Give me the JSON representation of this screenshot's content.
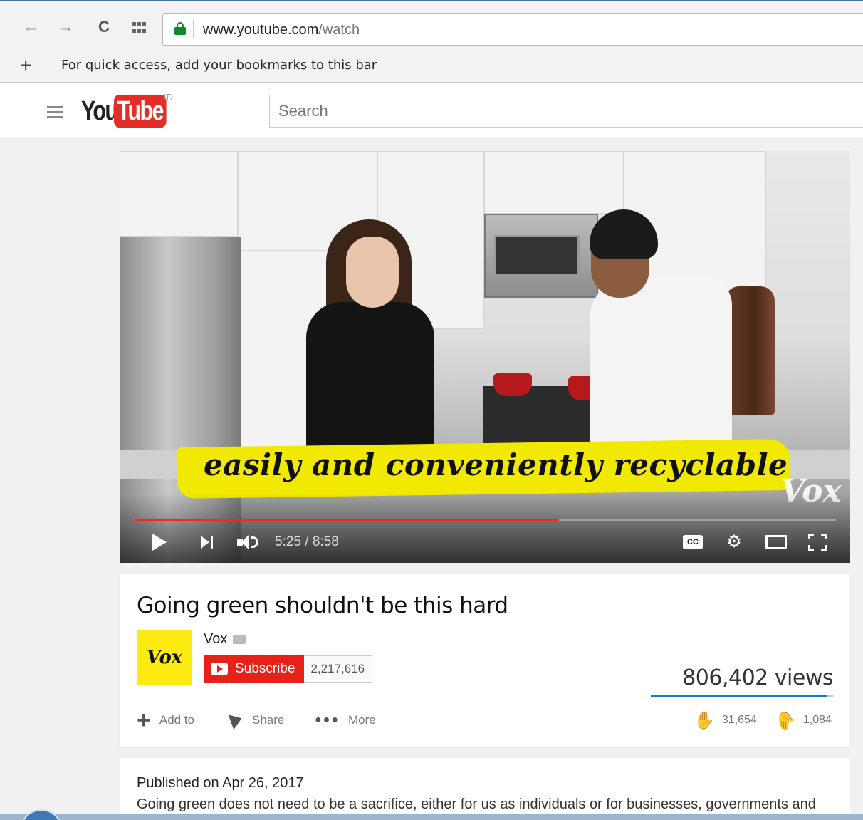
{
  "browser": {
    "url_domain": "www.youtube.com",
    "url_path": "/watch",
    "bookmarks_hint": "For quick access, add your bookmarks to this bar",
    "icons": [
      "back-icon",
      "forward-icon",
      "reload-icon",
      "apps-icon",
      "lock-icon",
      "add-bookmark-icon"
    ]
  },
  "header": {
    "logo_you": "You",
    "logo_tube": "Tube",
    "logo_region": "ID",
    "search_placeholder": "Search"
  },
  "player": {
    "caption": "easily and conveniently recyclable",
    "watermark": "Vox",
    "time_current": "5:25",
    "time_separator": " / ",
    "time_total": "8:58",
    "progress_fraction": 0.605,
    "cc_label": "CC",
    "accent_color": "#e52d27"
  },
  "video": {
    "title": "Going green shouldn't be this hard",
    "channel_name": "Vox",
    "channel_avatar_text": "Vox",
    "subscribe_label": "Subscribe",
    "subscriber_count": "2,217,616",
    "views": "806,402 views",
    "like_ratio": 0.967,
    "actions": {
      "add_to": "Add to",
      "share": "Share",
      "more": "More"
    },
    "likes": "31,654",
    "dislikes": "1,084"
  },
  "description": {
    "published": "Published on Apr 26, 2017",
    "text": "Going green does not need to be a sacrifice, either for us as individuals or for businesses, governments and"
  }
}
